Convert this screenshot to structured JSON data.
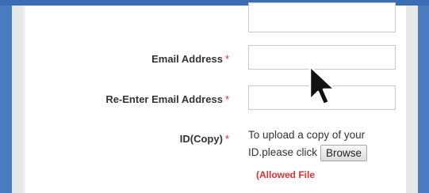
{
  "form": {
    "email": {
      "label": "Email Address",
      "required_mark": "*",
      "value": ""
    },
    "reenter_email": {
      "label": "Re-Enter Email Address",
      "required_mark": "*",
      "value": ""
    },
    "id_copy": {
      "label": "ID(Copy)",
      "required_mark": "*",
      "upload_text": "To upload a copy of your ID.please click",
      "browse_label": "Browse",
      "allowed_note": "(Allowed File"
    }
  },
  "colors": {
    "background_frame": "#4a7cc0",
    "required": "#e03030"
  },
  "icons": [
    "mouse-pointer-icon"
  ]
}
